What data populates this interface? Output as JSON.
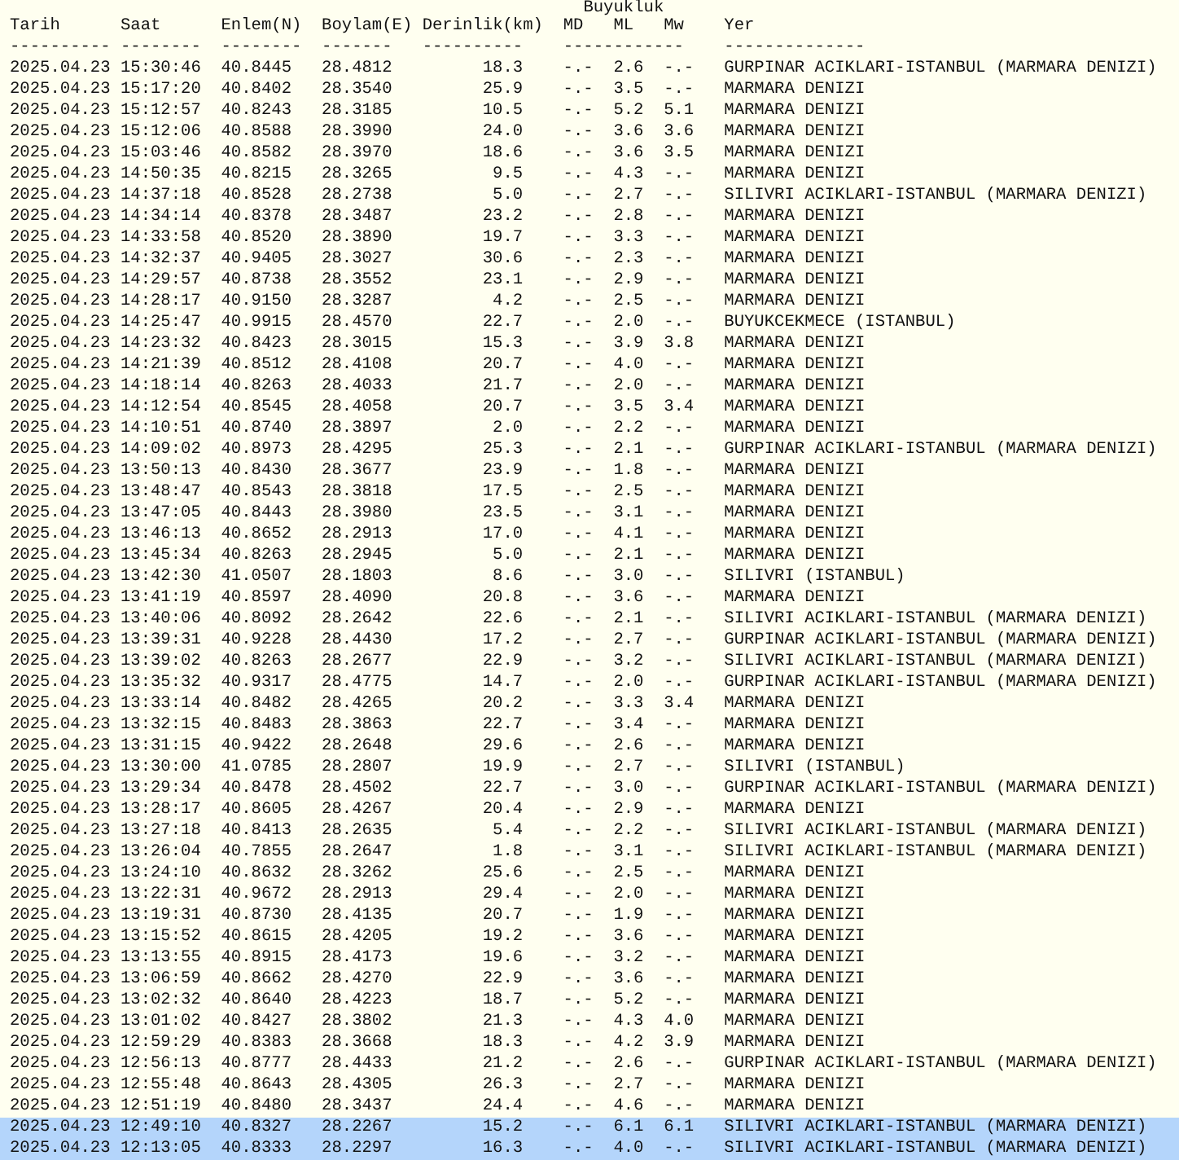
{
  "table": {
    "group_header": {
      "label": "Buyukluk",
      "rule": "------------"
    },
    "columns": [
      {
        "label": "Tarih",
        "rule": "----------"
      },
      {
        "label": "Saat",
        "rule": "--------"
      },
      {
        "label": "Enlem(N)",
        "rule": "--------"
      },
      {
        "label": "Boylam(E)",
        "rule": "-------"
      },
      {
        "label": "Derinlik(km)",
        "rule": "----------"
      },
      {
        "label": "MD"
      },
      {
        "label": "ML"
      },
      {
        "label": "Mw"
      },
      {
        "label": "Yer",
        "rule": "--------------"
      }
    ],
    "rows": [
      {
        "cells": [
          "2025.04.23",
          "15:30:46",
          "40.8445",
          "28.4812",
          "18.3",
          "-.-",
          "2.6",
          "-.-",
          "GURPINAR ACIKLARI-ISTANBUL (MARMARA DENIZI)"
        ],
        "selected": false
      },
      {
        "cells": [
          "2025.04.23",
          "15:17:20",
          "40.8402",
          "28.3540",
          "25.9",
          "-.-",
          "3.5",
          "-.-",
          "MARMARA DENIZI"
        ],
        "selected": false
      },
      {
        "cells": [
          "2025.04.23",
          "15:12:57",
          "40.8243",
          "28.3185",
          "10.5",
          "-.-",
          "5.2",
          "5.1",
          "MARMARA DENIZI"
        ],
        "selected": false
      },
      {
        "cells": [
          "2025.04.23",
          "15:12:06",
          "40.8588",
          "28.3990",
          "24.0",
          "-.-",
          "3.6",
          "3.6",
          "MARMARA DENIZI"
        ],
        "selected": false
      },
      {
        "cells": [
          "2025.04.23",
          "15:03:46",
          "40.8582",
          "28.3970",
          "18.6",
          "-.-",
          "3.6",
          "3.5",
          "MARMARA DENIZI"
        ],
        "selected": false
      },
      {
        "cells": [
          "2025.04.23",
          "14:50:35",
          "40.8215",
          "28.3265",
          "9.5",
          "-.-",
          "4.3",
          "-.-",
          "MARMARA DENIZI"
        ],
        "selected": false
      },
      {
        "cells": [
          "2025.04.23",
          "14:37:18",
          "40.8528",
          "28.2738",
          "5.0",
          "-.-",
          "2.7",
          "-.-",
          "SILIVRI ACIKLARI-ISTANBUL (MARMARA DENIZI)"
        ],
        "selected": false
      },
      {
        "cells": [
          "2025.04.23",
          "14:34:14",
          "40.8378",
          "28.3487",
          "23.2",
          "-.-",
          "2.8",
          "-.-",
          "MARMARA DENIZI"
        ],
        "selected": false
      },
      {
        "cells": [
          "2025.04.23",
          "14:33:58",
          "40.8520",
          "28.3890",
          "19.7",
          "-.-",
          "3.3",
          "-.-",
          "MARMARA DENIZI"
        ],
        "selected": false
      },
      {
        "cells": [
          "2025.04.23",
          "14:32:37",
          "40.9405",
          "28.3027",
          "30.6",
          "-.-",
          "2.3",
          "-.-",
          "MARMARA DENIZI"
        ],
        "selected": false
      },
      {
        "cells": [
          "2025.04.23",
          "14:29:57",
          "40.8738",
          "28.3552",
          "23.1",
          "-.-",
          "2.9",
          "-.-",
          "MARMARA DENIZI"
        ],
        "selected": false
      },
      {
        "cells": [
          "2025.04.23",
          "14:28:17",
          "40.9150",
          "28.3287",
          "4.2",
          "-.-",
          "2.5",
          "-.-",
          "MARMARA DENIZI"
        ],
        "selected": false
      },
      {
        "cells": [
          "2025.04.23",
          "14:25:47",
          "40.9915",
          "28.4570",
          "22.7",
          "-.-",
          "2.0",
          "-.-",
          "BUYUKCEKMECE (ISTANBUL)"
        ],
        "selected": false
      },
      {
        "cells": [
          "2025.04.23",
          "14:23:32",
          "40.8423",
          "28.3015",
          "15.3",
          "-.-",
          "3.9",
          "3.8",
          "MARMARA DENIZI"
        ],
        "selected": false
      },
      {
        "cells": [
          "2025.04.23",
          "14:21:39",
          "40.8512",
          "28.4108",
          "20.7",
          "-.-",
          "4.0",
          "-.-",
          "MARMARA DENIZI"
        ],
        "selected": false
      },
      {
        "cells": [
          "2025.04.23",
          "14:18:14",
          "40.8263",
          "28.4033",
          "21.7",
          "-.-",
          "2.0",
          "-.-",
          "MARMARA DENIZI"
        ],
        "selected": false
      },
      {
        "cells": [
          "2025.04.23",
          "14:12:54",
          "40.8545",
          "28.4058",
          "20.7",
          "-.-",
          "3.5",
          "3.4",
          "MARMARA DENIZI"
        ],
        "selected": false
      },
      {
        "cells": [
          "2025.04.23",
          "14:10:51",
          "40.8740",
          "28.3897",
          "2.0",
          "-.-",
          "2.2",
          "-.-",
          "MARMARA DENIZI"
        ],
        "selected": false
      },
      {
        "cells": [
          "2025.04.23",
          "14:09:02",
          "40.8973",
          "28.4295",
          "25.3",
          "-.-",
          "2.1",
          "-.-",
          "GURPINAR ACIKLARI-ISTANBUL (MARMARA DENIZI)"
        ],
        "selected": false
      },
      {
        "cells": [
          "2025.04.23",
          "13:50:13",
          "40.8430",
          "28.3677",
          "23.9",
          "-.-",
          "1.8",
          "-.-",
          "MARMARA DENIZI"
        ],
        "selected": false
      },
      {
        "cells": [
          "2025.04.23",
          "13:48:47",
          "40.8543",
          "28.3818",
          "17.5",
          "-.-",
          "2.5",
          "-.-",
          "MARMARA DENIZI"
        ],
        "selected": false
      },
      {
        "cells": [
          "2025.04.23",
          "13:47:05",
          "40.8443",
          "28.3980",
          "23.5",
          "-.-",
          "3.1",
          "-.-",
          "MARMARA DENIZI"
        ],
        "selected": false
      },
      {
        "cells": [
          "2025.04.23",
          "13:46:13",
          "40.8652",
          "28.2913",
          "17.0",
          "-.-",
          "4.1",
          "-.-",
          "MARMARA DENIZI"
        ],
        "selected": false
      },
      {
        "cells": [
          "2025.04.23",
          "13:45:34",
          "40.8263",
          "28.2945",
          "5.0",
          "-.-",
          "2.1",
          "-.-",
          "MARMARA DENIZI"
        ],
        "selected": false
      },
      {
        "cells": [
          "2025.04.23",
          "13:42:30",
          "41.0507",
          "28.1803",
          "8.6",
          "-.-",
          "3.0",
          "-.-",
          "SILIVRI (ISTANBUL)"
        ],
        "selected": false
      },
      {
        "cells": [
          "2025.04.23",
          "13:41:19",
          "40.8597",
          "28.4090",
          "20.8",
          "-.-",
          "3.6",
          "-.-",
          "MARMARA DENIZI"
        ],
        "selected": false
      },
      {
        "cells": [
          "2025.04.23",
          "13:40:06",
          "40.8092",
          "28.2642",
          "22.6",
          "-.-",
          "2.1",
          "-.-",
          "SILIVRI ACIKLARI-ISTANBUL (MARMARA DENIZI)"
        ],
        "selected": false
      },
      {
        "cells": [
          "2025.04.23",
          "13:39:31",
          "40.9228",
          "28.4430",
          "17.2",
          "-.-",
          "2.7",
          "-.-",
          "GURPINAR ACIKLARI-ISTANBUL (MARMARA DENIZI)"
        ],
        "selected": false
      },
      {
        "cells": [
          "2025.04.23",
          "13:39:02",
          "40.8263",
          "28.2677",
          "22.9",
          "-.-",
          "3.2",
          "-.-",
          "SILIVRI ACIKLARI-ISTANBUL (MARMARA DENIZI)"
        ],
        "selected": false
      },
      {
        "cells": [
          "2025.04.23",
          "13:35:32",
          "40.9317",
          "28.4775",
          "14.7",
          "-.-",
          "2.0",
          "-.-",
          "GURPINAR ACIKLARI-ISTANBUL (MARMARA DENIZI)"
        ],
        "selected": false
      },
      {
        "cells": [
          "2025.04.23",
          "13:33:14",
          "40.8482",
          "28.4265",
          "20.2",
          "-.-",
          "3.3",
          "3.4",
          "MARMARA DENIZI"
        ],
        "selected": false
      },
      {
        "cells": [
          "2025.04.23",
          "13:32:15",
          "40.8483",
          "28.3863",
          "22.7",
          "-.-",
          "3.4",
          "-.-",
          "MARMARA DENIZI"
        ],
        "selected": false
      },
      {
        "cells": [
          "2025.04.23",
          "13:31:15",
          "40.9422",
          "28.2648",
          "29.6",
          "-.-",
          "2.6",
          "-.-",
          "MARMARA DENIZI"
        ],
        "selected": false
      },
      {
        "cells": [
          "2025.04.23",
          "13:30:00",
          "41.0785",
          "28.2807",
          "19.9",
          "-.-",
          "2.7",
          "-.-",
          "SILIVRI (ISTANBUL)"
        ],
        "selected": false
      },
      {
        "cells": [
          "2025.04.23",
          "13:29:34",
          "40.8478",
          "28.4502",
          "22.7",
          "-.-",
          "3.0",
          "-.-",
          "GURPINAR ACIKLARI-ISTANBUL (MARMARA DENIZI)"
        ],
        "selected": false
      },
      {
        "cells": [
          "2025.04.23",
          "13:28:17",
          "40.8605",
          "28.4267",
          "20.4",
          "-.-",
          "2.9",
          "-.-",
          "MARMARA DENIZI"
        ],
        "selected": false
      },
      {
        "cells": [
          "2025.04.23",
          "13:27:18",
          "40.8413",
          "28.2635",
          "5.4",
          "-.-",
          "2.2",
          "-.-",
          "SILIVRI ACIKLARI-ISTANBUL (MARMARA DENIZI)"
        ],
        "selected": false
      },
      {
        "cells": [
          "2025.04.23",
          "13:26:04",
          "40.7855",
          "28.2647",
          "1.8",
          "-.-",
          "3.1",
          "-.-",
          "SILIVRI ACIKLARI-ISTANBUL (MARMARA DENIZI)"
        ],
        "selected": false
      },
      {
        "cells": [
          "2025.04.23",
          "13:24:10",
          "40.8632",
          "28.3262",
          "25.6",
          "-.-",
          "2.5",
          "-.-",
          "MARMARA DENIZI"
        ],
        "selected": false
      },
      {
        "cells": [
          "2025.04.23",
          "13:22:31",
          "40.9672",
          "28.2913",
          "29.4",
          "-.-",
          "2.0",
          "-.-",
          "MARMARA DENIZI"
        ],
        "selected": false
      },
      {
        "cells": [
          "2025.04.23",
          "13:19:31",
          "40.8730",
          "28.4135",
          "20.7",
          "-.-",
          "1.9",
          "-.-",
          "MARMARA DENIZI"
        ],
        "selected": false
      },
      {
        "cells": [
          "2025.04.23",
          "13:15:52",
          "40.8615",
          "28.4205",
          "19.2",
          "-.-",
          "3.6",
          "-.-",
          "MARMARA DENIZI"
        ],
        "selected": false
      },
      {
        "cells": [
          "2025.04.23",
          "13:13:55",
          "40.8915",
          "28.4173",
          "19.6",
          "-.-",
          "3.2",
          "-.-",
          "MARMARA DENIZI"
        ],
        "selected": false
      },
      {
        "cells": [
          "2025.04.23",
          "13:06:59",
          "40.8662",
          "28.4270",
          "22.9",
          "-.-",
          "3.6",
          "-.-",
          "MARMARA DENIZI"
        ],
        "selected": false
      },
      {
        "cells": [
          "2025.04.23",
          "13:02:32",
          "40.8640",
          "28.4223",
          "18.7",
          "-.-",
          "5.2",
          "-.-",
          "MARMARA DENIZI"
        ],
        "selected": false
      },
      {
        "cells": [
          "2025.04.23",
          "13:01:02",
          "40.8427",
          "28.3802",
          "21.3",
          "-.-",
          "4.3",
          "4.0",
          "MARMARA DENIZI"
        ],
        "selected": false
      },
      {
        "cells": [
          "2025.04.23",
          "12:59:29",
          "40.8383",
          "28.3668",
          "18.3",
          "-.-",
          "4.2",
          "3.9",
          "MARMARA DENIZI"
        ],
        "selected": false
      },
      {
        "cells": [
          "2025.04.23",
          "12:56:13",
          "40.8777",
          "28.4433",
          "21.2",
          "-.-",
          "2.6",
          "-.-",
          "GURPINAR ACIKLARI-ISTANBUL (MARMARA DENIZI)"
        ],
        "selected": false
      },
      {
        "cells": [
          "2025.04.23",
          "12:55:48",
          "40.8643",
          "28.4305",
          "26.3",
          "-.-",
          "2.7",
          "-.-",
          "MARMARA DENIZI"
        ],
        "selected": false
      },
      {
        "cells": [
          "2025.04.23",
          "12:51:19",
          "40.8480",
          "28.3437",
          "24.4",
          "-.-",
          "4.6",
          "-.-",
          "MARMARA DENIZI"
        ],
        "selected": false
      },
      {
        "cells": [
          "2025.04.23",
          "12:49:10",
          "40.8327",
          "28.2267",
          "15.2",
          "-.-",
          "6.1",
          "6.1",
          "SILIVRI ACIKLARI-ISTANBUL (MARMARA DENIZI)"
        ],
        "selected": true
      },
      {
        "cells": [
          "2025.04.23",
          "12:13:05",
          "40.8333",
          "28.2297",
          "16.3",
          "-.-",
          "4.0",
          "-.-",
          "SILIVRI ACIKLARI-ISTANBUL (MARMARA DENIZI)"
        ],
        "selected": true
      }
    ]
  }
}
